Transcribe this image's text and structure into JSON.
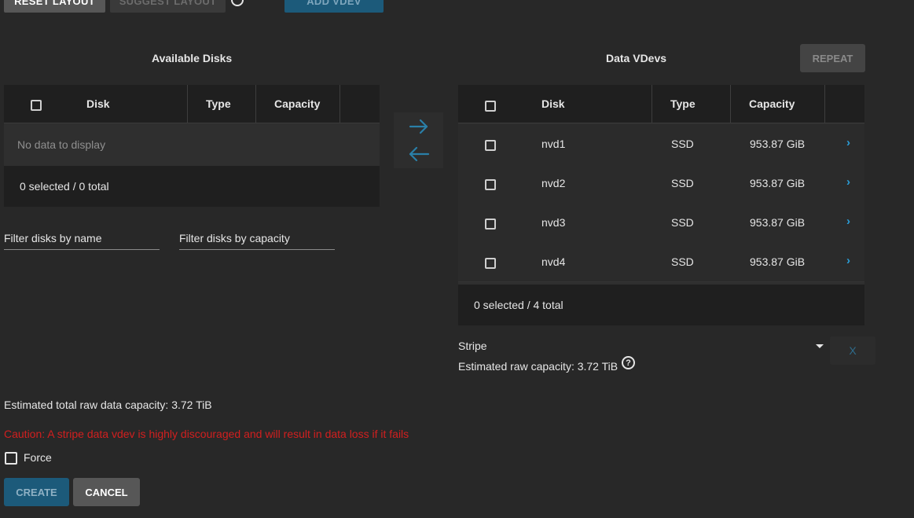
{
  "toolbar": {
    "reset_label": "RESET LAYOUT",
    "suggest_label": "SUGGEST LAYOUT",
    "add_vdev_label": "ADD VDEV"
  },
  "available": {
    "title": "Available Disks",
    "columns": [
      "Disk",
      "Type",
      "Capacity"
    ],
    "empty_text": "No data to display",
    "footer": "0 selected / 0 total",
    "filter_name_placeholder": "Filter disks by name",
    "filter_capacity_placeholder": "Filter disks by capacity"
  },
  "data_vdevs": {
    "title": "Data VDevs",
    "repeat_label": "REPEAT",
    "columns": [
      "Disk",
      "Type",
      "Capacity"
    ],
    "rows": [
      {
        "disk": "nvd1",
        "type": "SSD",
        "capacity": "953.87 GiB"
      },
      {
        "disk": "nvd2",
        "type": "SSD",
        "capacity": "953.87 GiB"
      },
      {
        "disk": "nvd3",
        "type": "SSD",
        "capacity": "953.87 GiB"
      },
      {
        "disk": "nvd4",
        "type": "SSD",
        "capacity": "953.87 GiB"
      }
    ],
    "footer": "0 selected / 4 total",
    "layout_value": "Stripe",
    "estimated_raw": "Estimated raw capacity: 3.72 TiB",
    "remove_label": "X"
  },
  "summary": {
    "estimated_total": "Estimated total raw data capacity: 3.72 TiB",
    "caution": "Caution: A stripe data vdev is highly discouraged and will result in data loss if it fails",
    "force_label": "Force"
  },
  "actions": {
    "create_label": "CREATE",
    "cancel_label": "CANCEL"
  },
  "colors": {
    "background": "#282828",
    "accent": "#2a9ed8",
    "primary_button": "#1c5a7a",
    "caution": "#d21f1f"
  }
}
